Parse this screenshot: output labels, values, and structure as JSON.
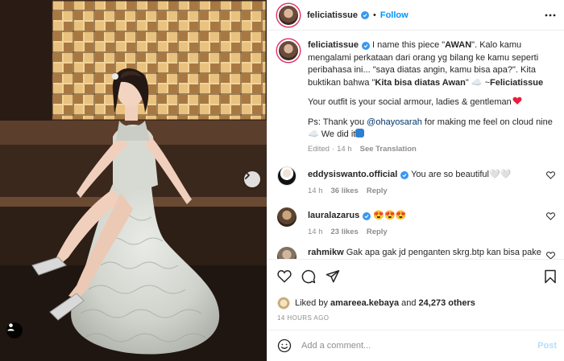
{
  "header": {
    "username": "feliciatissue",
    "separator": "•",
    "follow_label": "Follow",
    "more_icon": "more-icon"
  },
  "caption": {
    "username": "feliciatissue",
    "line1_pre": "I name this piece \"",
    "line1_bold": "AWAN",
    "line1_post": "\". Kalo kamu mengalami perkataan dari orang yg bilang ke kamu seperti peribahasa ini... \"saya diatas angin, kamu bisa apa?\". Kita buktikan bahwa \"",
    "quote_bold": "Kita bisa diatas Awan",
    "quote_post": "\" ☁️ ~",
    "signature": "Feliciatissue",
    "para2": "Your outfit is your social armour, ladies & gentleman",
    "para3_pre": "Ps: Thank you ",
    "mention": "@ohayosarah",
    "para3_post": " for making me feel on cloud nine☁️ We did it",
    "edited": "Edited",
    "time": "14 h",
    "see_translation": "See Translation"
  },
  "comments": [
    {
      "username": "eddysiswanto.official",
      "verified": true,
      "text": "You are so beautiful🤍🤍",
      "time": "14 h",
      "likes": "36 likes",
      "reply": "Reply"
    },
    {
      "username": "lauralazarus",
      "verified": true,
      "text": "😍😍😍",
      "time": "14 h",
      "likes": "23 likes",
      "reply": "Reply"
    },
    {
      "username": "rahmikw",
      "verified": false,
      "text": "Gak apa gak jd penganten skrg.btp kan bisa pake"
    }
  ],
  "actions": {
    "icons": [
      "heart-icon",
      "comment-icon",
      "share-icon",
      "bookmark-icon"
    ]
  },
  "likes": {
    "prefix": "Liked by",
    "user": "amareea.kebaya",
    "and": "and",
    "count": "24,273 others"
  },
  "timestamp": "14 HOURS AGO",
  "comment_box": {
    "placeholder": "Add a comment...",
    "post_label": "Post"
  },
  "colors": {
    "accent": "#0095f6",
    "verified": "#3897f0",
    "heart": "#ed4956",
    "muted": "#8e8e8e"
  }
}
